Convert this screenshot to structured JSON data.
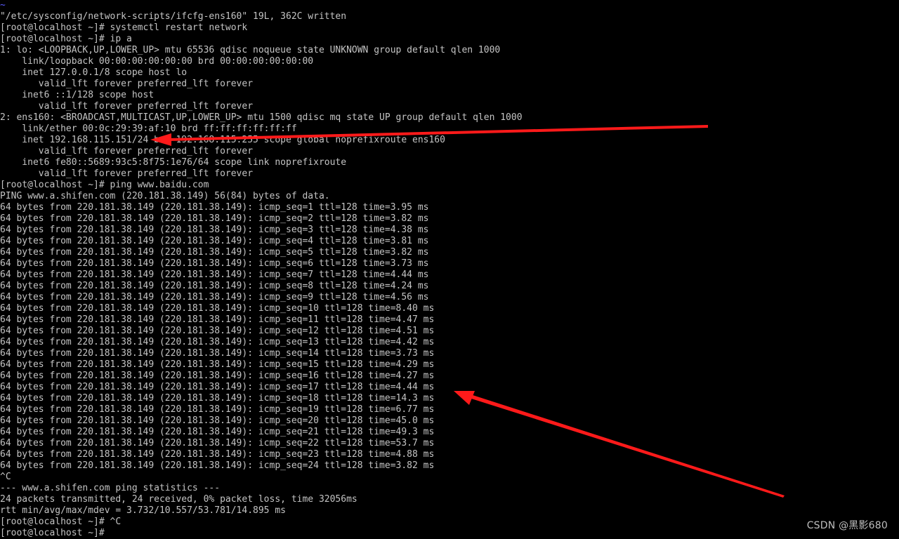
{
  "terminal": {
    "background": "#000000",
    "foreground": "#c4c4c4",
    "tilde_color": "#5a5aff",
    "lines": [
      "~",
      "\"/etc/sysconfig/network-scripts/ifcfg-ens160\" 19L, 362C written",
      "[root@localhost ~]# systemctl restart network",
      "[root@localhost ~]# ip a",
      "1: lo: <LOOPBACK,UP,LOWER_UP> mtu 65536 qdisc noqueue state UNKNOWN group default qlen 1000",
      "    link/loopback 00:00:00:00:00:00 brd 00:00:00:00:00:00",
      "    inet 127.0.0.1/8 scope host lo",
      "       valid_lft forever preferred_lft forever",
      "    inet6 ::1/128 scope host",
      "       valid_lft forever preferred_lft forever",
      "2: ens160: <BROADCAST,MULTICAST,UP,LOWER_UP> mtu 1500 qdisc mq state UP group default qlen 1000",
      "    link/ether 00:0c:29:39:af:10 brd ff:ff:ff:ff:ff:ff",
      "    inet 192.168.115.151/24 brd 192.168.115.255 scope global noprefixroute ens160",
      "       valid_lft forever preferred_lft forever",
      "    inet6 fe80::5689:93c5:8f75:1e76/64 scope link noprefixroute",
      "       valid_lft forever preferred_lft forever",
      "[root@localhost ~]# ping www.baidu.com",
      "PING www.a.shifen.com (220.181.38.149) 56(84) bytes of data.",
      "64 bytes from 220.181.38.149 (220.181.38.149): icmp_seq=1 ttl=128 time=3.95 ms",
      "64 bytes from 220.181.38.149 (220.181.38.149): icmp_seq=2 ttl=128 time=3.82 ms",
      "64 bytes from 220.181.38.149 (220.181.38.149): icmp_seq=3 ttl=128 time=4.38 ms",
      "64 bytes from 220.181.38.149 (220.181.38.149): icmp_seq=4 ttl=128 time=3.81 ms",
      "64 bytes from 220.181.38.149 (220.181.38.149): icmp_seq=5 ttl=128 time=3.82 ms",
      "64 bytes from 220.181.38.149 (220.181.38.149): icmp_seq=6 ttl=128 time=3.73 ms",
      "64 bytes from 220.181.38.149 (220.181.38.149): icmp_seq=7 ttl=128 time=4.44 ms",
      "64 bytes from 220.181.38.149 (220.181.38.149): icmp_seq=8 ttl=128 time=4.24 ms",
      "64 bytes from 220.181.38.149 (220.181.38.149): icmp_seq=9 ttl=128 time=4.56 ms",
      "64 bytes from 220.181.38.149 (220.181.38.149): icmp_seq=10 ttl=128 time=8.40 ms",
      "64 bytes from 220.181.38.149 (220.181.38.149): icmp_seq=11 ttl=128 time=4.47 ms",
      "64 bytes from 220.181.38.149 (220.181.38.149): icmp_seq=12 ttl=128 time=4.51 ms",
      "64 bytes from 220.181.38.149 (220.181.38.149): icmp_seq=13 ttl=128 time=4.42 ms",
      "64 bytes from 220.181.38.149 (220.181.38.149): icmp_seq=14 ttl=128 time=3.73 ms",
      "64 bytes from 220.181.38.149 (220.181.38.149): icmp_seq=15 ttl=128 time=4.29 ms",
      "64 bytes from 220.181.38.149 (220.181.38.149): icmp_seq=16 ttl=128 time=4.27 ms",
      "64 bytes from 220.181.38.149 (220.181.38.149): icmp_seq=17 ttl=128 time=4.44 ms",
      "64 bytes from 220.181.38.149 (220.181.38.149): icmp_seq=18 ttl=128 time=14.3 ms",
      "64 bytes from 220.181.38.149 (220.181.38.149): icmp_seq=19 ttl=128 time=6.77 ms",
      "64 bytes from 220.181.38.149 (220.181.38.149): icmp_seq=20 ttl=128 time=45.0 ms",
      "64 bytes from 220.181.38.149 (220.181.38.149): icmp_seq=21 ttl=128 time=49.3 ms",
      "64 bytes from 220.181.38.149 (220.181.38.149): icmp_seq=22 ttl=128 time=53.7 ms",
      "64 bytes from 220.181.38.149 (220.181.38.149): icmp_seq=23 ttl=128 time=4.88 ms",
      "64 bytes from 220.181.38.149 (220.181.38.149): icmp_seq=24 ttl=128 time=3.82 ms",
      "^C",
      "--- www.a.shifen.com ping statistics ---",
      "24 packets transmitted, 24 received, 0% packet loss, time 32056ms",
      "rtt min/avg/max/mdev = 3.732/10.557/53.781/14.895 ms",
      "[root@localhost ~]# ^C",
      "[root@localhost ~]#"
    ]
  },
  "annotations": {
    "arrow_color": "#ff1a1a",
    "arrows": [
      {
        "name": "arrow-to-inet-address"
      },
      {
        "name": "arrow-to-ping-results"
      }
    ]
  },
  "watermark": {
    "text": "CSDN @黑影680"
  }
}
